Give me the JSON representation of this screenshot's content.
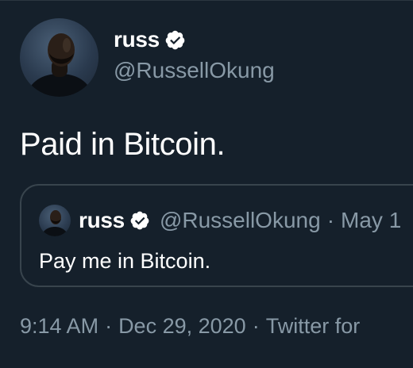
{
  "author": {
    "name": "russ",
    "handle": "@RussellOkung",
    "verified": true
  },
  "tweet": {
    "text": "Paid in Bitcoin."
  },
  "quoted_tweet": {
    "name": "russ",
    "handle": "@RussellOkung",
    "separator": "·",
    "date": "May 1",
    "text": "Pay me in Bitcoin."
  },
  "meta": {
    "time": "9:14 AM",
    "separator": "·",
    "date": "Dec 29, 2020",
    "source": "Twitter for"
  },
  "colors": {
    "background": "#15202b",
    "primary_text": "#ffffff",
    "secondary_text": "#8899a6",
    "border": "#38444d"
  },
  "icons": {
    "verified": "verified-badge-icon"
  }
}
